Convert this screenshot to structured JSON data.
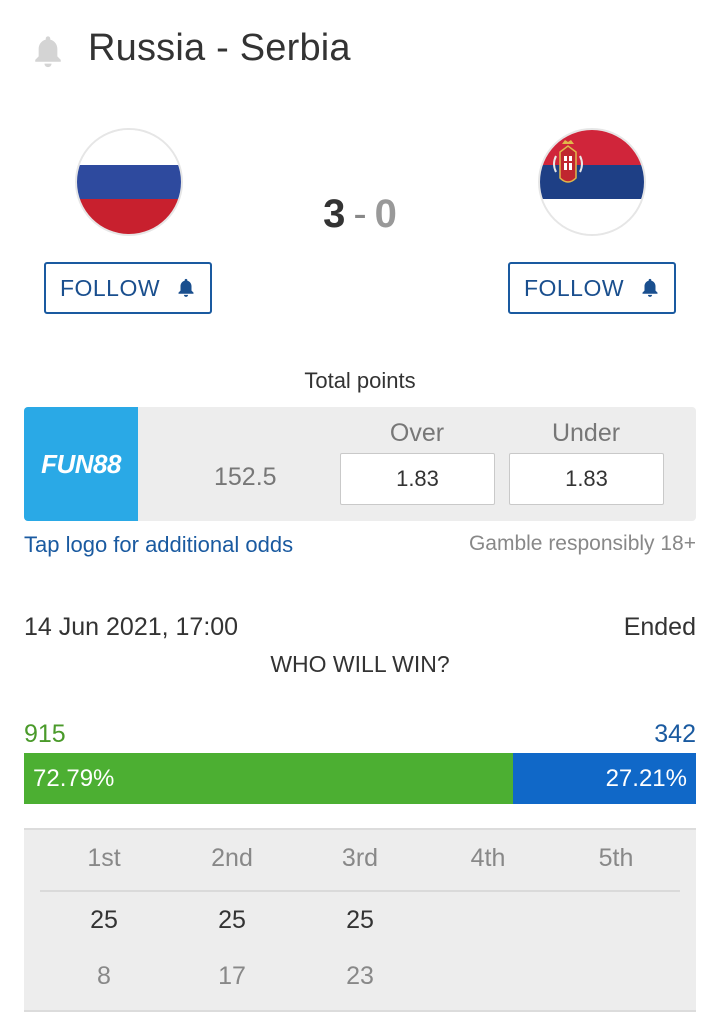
{
  "header": {
    "title": "Russia - Serbia",
    "bell_icon": "bell-icon"
  },
  "match": {
    "home_team": "Russia",
    "away_team": "Serbia",
    "home_score": "3",
    "separator": "-",
    "away_score": "0"
  },
  "follow": {
    "home_label": "FOLLOW",
    "away_label": "FOLLOW"
  },
  "odds": {
    "title": "Total points",
    "logo_text": "FUN88",
    "line": "152.5",
    "over_label": "Over",
    "under_label": "Under",
    "over_value": "1.83",
    "under_value": "1.83",
    "tap_logo": "Tap logo for additional odds",
    "gamble": "Gamble responsibly 18+"
  },
  "info": {
    "date": "14 Jun 2021, 17:00",
    "status": "Ended",
    "who_will_win": "WHO WILL WIN?"
  },
  "votes": {
    "home_count": "915",
    "away_count": "342",
    "home_percent": "72.79%",
    "away_percent": "27.21%",
    "home_share": 0.7279
  },
  "sets": {
    "headers": [
      "1st",
      "2nd",
      "3rd",
      "4th",
      "5th"
    ],
    "home": [
      "25",
      "25",
      "25",
      "",
      ""
    ],
    "away": [
      "8",
      "17",
      "23",
      "",
      ""
    ]
  },
  "colors": {
    "accent": "#1a5aa0",
    "home_vote": "#4caf32",
    "away_vote": "#1068c8",
    "logo_bg": "#2aa9e6"
  }
}
